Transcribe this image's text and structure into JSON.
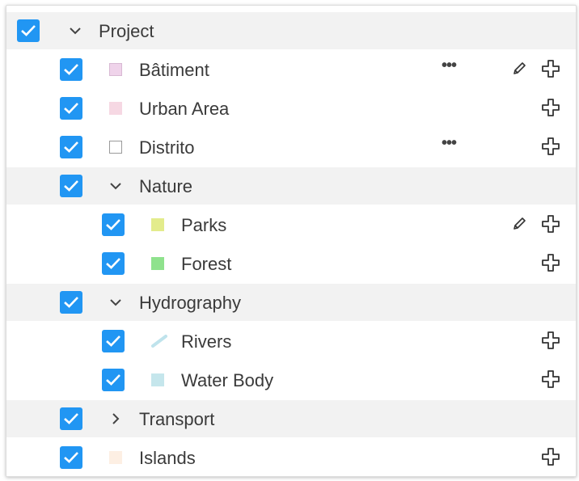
{
  "layer_tree": {
    "root": {
      "label": "Project",
      "checked": true,
      "expanded": true
    },
    "items": [
      {
        "label": "Bâtiment",
        "checked": true,
        "swatch_color": "#efd3ea",
        "swatch_border": "#d8b9d3",
        "actions": [
          "more",
          "edit",
          "add"
        ]
      },
      {
        "label": "Urban Area",
        "checked": true,
        "swatch_color": "#f6d8e3",
        "swatch_border": "#f6d8e3",
        "actions": [
          "add"
        ]
      },
      {
        "label": "Distrito",
        "checked": true,
        "swatch_color": "#ffffff",
        "swatch_border": "#9a9a9a",
        "actions": [
          "more",
          "add"
        ]
      },
      {
        "label": "Nature",
        "checked": true,
        "group": true,
        "expanded": true
      },
      {
        "label": "Parks",
        "checked": true,
        "swatch_color": "#e3ec8c",
        "swatch_border": "#e3ec8c",
        "actions": [
          "edit",
          "add"
        ]
      },
      {
        "label": "Forest",
        "checked": true,
        "swatch_color": "#8fe28d",
        "swatch_border": "#8fe28d",
        "actions": [
          "add"
        ]
      },
      {
        "label": "Hydrography",
        "checked": true,
        "group": true,
        "expanded": true
      },
      {
        "label": "Rivers",
        "checked": true,
        "swatch_icon": "river-line-icon",
        "swatch_color": "#bfe3ec",
        "actions": [
          "add"
        ]
      },
      {
        "label": "Water Body",
        "checked": true,
        "swatch_color": "#c5e6ec",
        "swatch_border": "#c5e6ec",
        "actions": [
          "add"
        ]
      },
      {
        "label": "Transport",
        "checked": true,
        "group": true,
        "expanded": false
      },
      {
        "label": "Islands",
        "checked": true,
        "swatch_color": "#fdefe3",
        "swatch_border": "#fdefe3",
        "actions": [
          "add"
        ]
      }
    ]
  },
  "icons": {
    "checkbox": "check-icon",
    "expanded": "chevron-down-icon",
    "collapsed": "chevron-right-icon",
    "more": "more-options-icon",
    "edit": "pencil-icon",
    "add": "plus-outline-icon"
  },
  "colors": {
    "checkbox_blue": "#2196f3",
    "group_row_bg": "#f2f2f2",
    "text": "#3a3a3a"
  },
  "more_glyph": "•••"
}
